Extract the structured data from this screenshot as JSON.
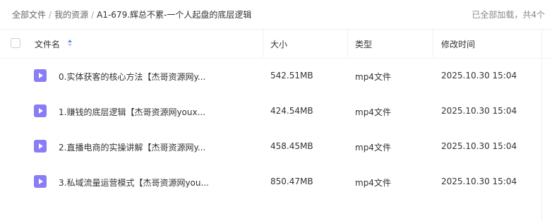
{
  "breadcrumb": {
    "items": [
      "全部文件",
      "我的资源",
      "A1-679.辉总不累-一个人起盘的底层逻辑"
    ]
  },
  "load_status": "已全部加载，共4个",
  "table": {
    "headers": {
      "name": "文件名",
      "size": "大小",
      "type": "类型",
      "modified": "修改时间"
    },
    "rows": [
      {
        "name": "0.实体获客的核心方法【杰哥资源网y...",
        "size": "542.51MB",
        "type": "mp4文件",
        "modified": "2025.10.30 15:04"
      },
      {
        "name": "1.赚钱的底层逻辑【杰哥资源网youx...",
        "size": "424.54MB",
        "type": "mp4文件",
        "modified": "2025.10.30 15:04"
      },
      {
        "name": "2.直播电商的实操讲解【杰哥资源网y...",
        "size": "458.45MB",
        "type": "mp4文件",
        "modified": "2025.10.30 15:04"
      },
      {
        "name": "3.私域流量运营模式【杰哥资源网you...",
        "size": "850.47MB",
        "type": "mp4文件",
        "modified": "2025.10.30 15:04"
      }
    ]
  },
  "colors": {
    "icon": "#8a7cf6",
    "sort_active": "#4c8bf5"
  }
}
